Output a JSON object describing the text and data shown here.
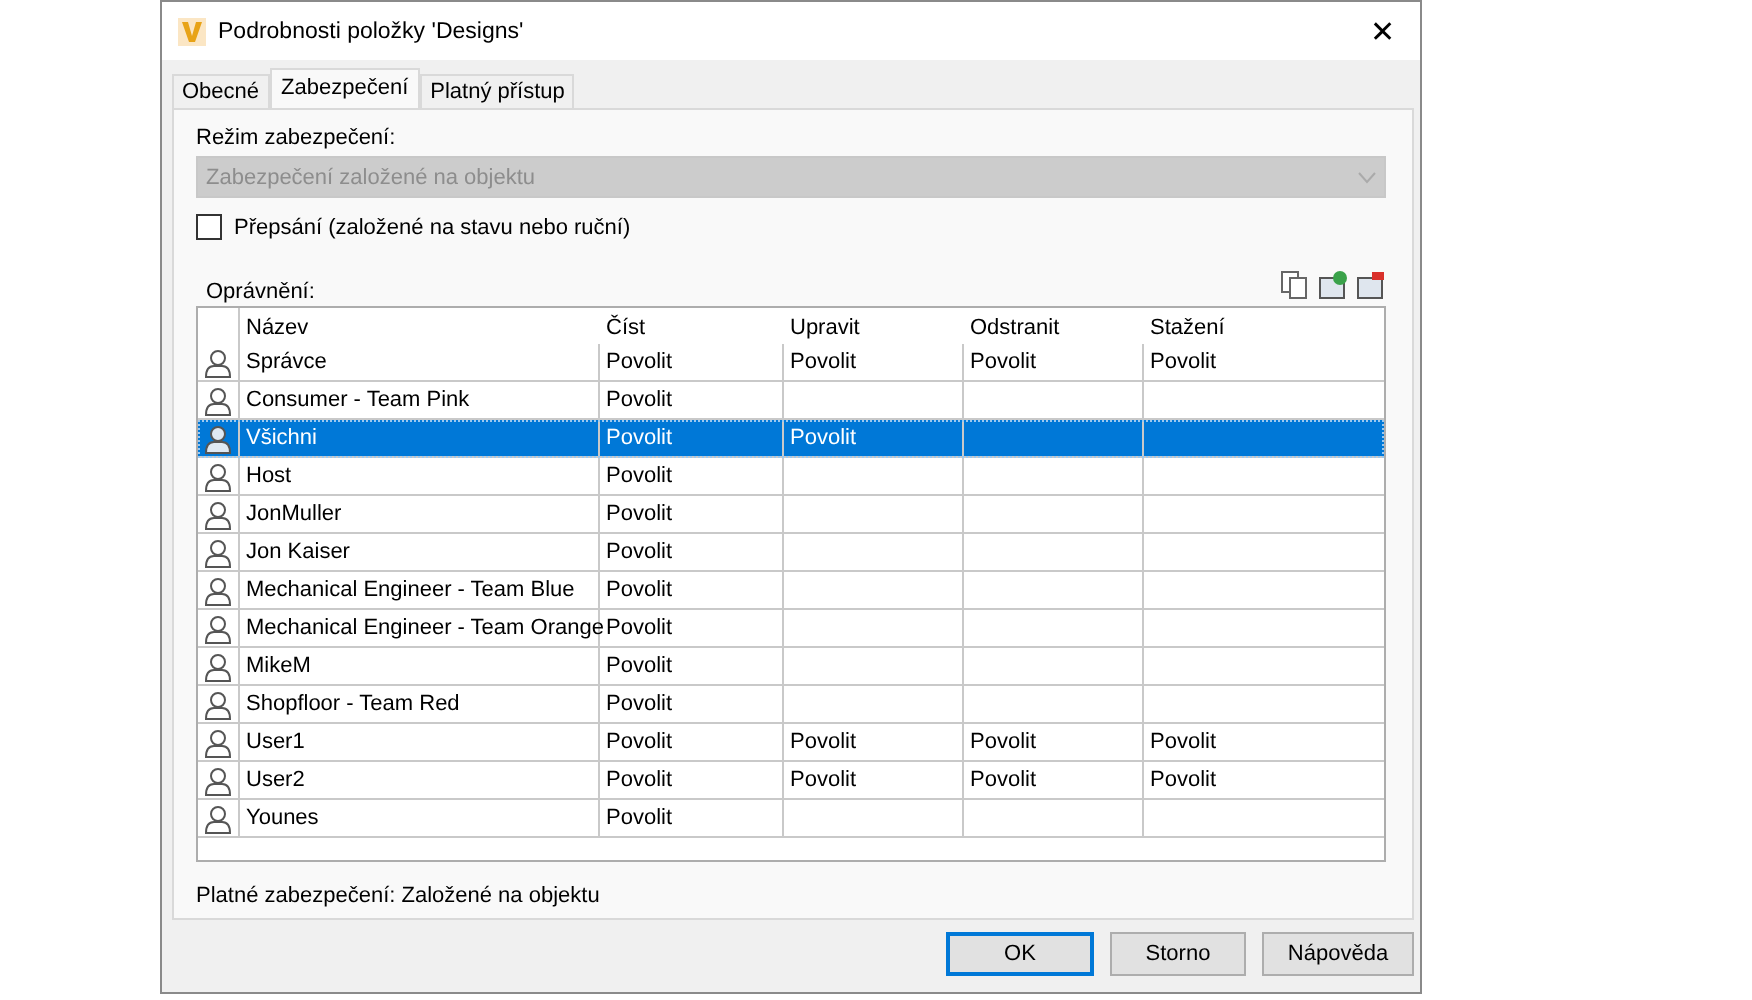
{
  "window": {
    "title": "Podrobnosti položky 'Designs'",
    "close": "✕"
  },
  "tabs": [
    {
      "label": "Obecné",
      "selected": false
    },
    {
      "label": "Zabezpečení",
      "selected": true
    },
    {
      "label": "Platný přístup",
      "selected": false
    }
  ],
  "security_mode": {
    "label": "Režim zabezpečení:",
    "value": "Zabezpečení založené na objektu",
    "disabled": true
  },
  "override": {
    "label": "Přepsání (založené na stavu nebo ruční)",
    "checked": false
  },
  "permissions": {
    "label": "Oprávnění:",
    "columns": [
      "Název",
      "Číst",
      "Upravit",
      "Odstranit",
      "Stažení"
    ],
    "rows": [
      {
        "selected": false,
        "cells": [
          "Správce",
          "Povolit",
          "Povolit",
          "Povolit",
          "Povolit"
        ]
      },
      {
        "selected": false,
        "cells": [
          "Consumer - Team Pink",
          "Povolit"
        ]
      },
      {
        "selected": true,
        "cells": [
          "Všichni",
          "Povolit",
          "Povolit"
        ]
      },
      {
        "selected": false,
        "cells": [
          "Host",
          "Povolit"
        ]
      },
      {
        "selected": false,
        "cells": [
          "JonMuller",
          "Povolit"
        ]
      },
      {
        "selected": false,
        "cells": [
          "Jon Kaiser",
          "Povolit"
        ]
      },
      {
        "selected": false,
        "cells": [
          "Mechanical Engineer - Team Blue",
          "Povolit"
        ]
      },
      {
        "selected": false,
        "cells": [
          "Mechanical Engineer - Team Orange",
          "Povolit"
        ]
      },
      {
        "selected": false,
        "cells": [
          "MikeM",
          "Povolit"
        ]
      },
      {
        "selected": false,
        "cells": [
          "Shopfloor - Team Red",
          "Povolit"
        ]
      },
      {
        "selected": false,
        "cells": [
          "User1",
          "Povolit",
          "Povolit",
          "Povolit",
          "Povolit"
        ]
      },
      {
        "selected": false,
        "cells": [
          "User2",
          "Povolit",
          "Povolit",
          "Povolit",
          "Povolit"
        ]
      },
      {
        "selected": false,
        "cells": [
          "Younes",
          "Povolit"
        ]
      }
    ]
  },
  "effective_security": "Platné zabezpečení: Založené na objektu",
  "buttons": [
    {
      "label": "OK",
      "default": true
    },
    {
      "label": "Storno",
      "default": false
    },
    {
      "label": "Nápověda",
      "default": false
    }
  ]
}
